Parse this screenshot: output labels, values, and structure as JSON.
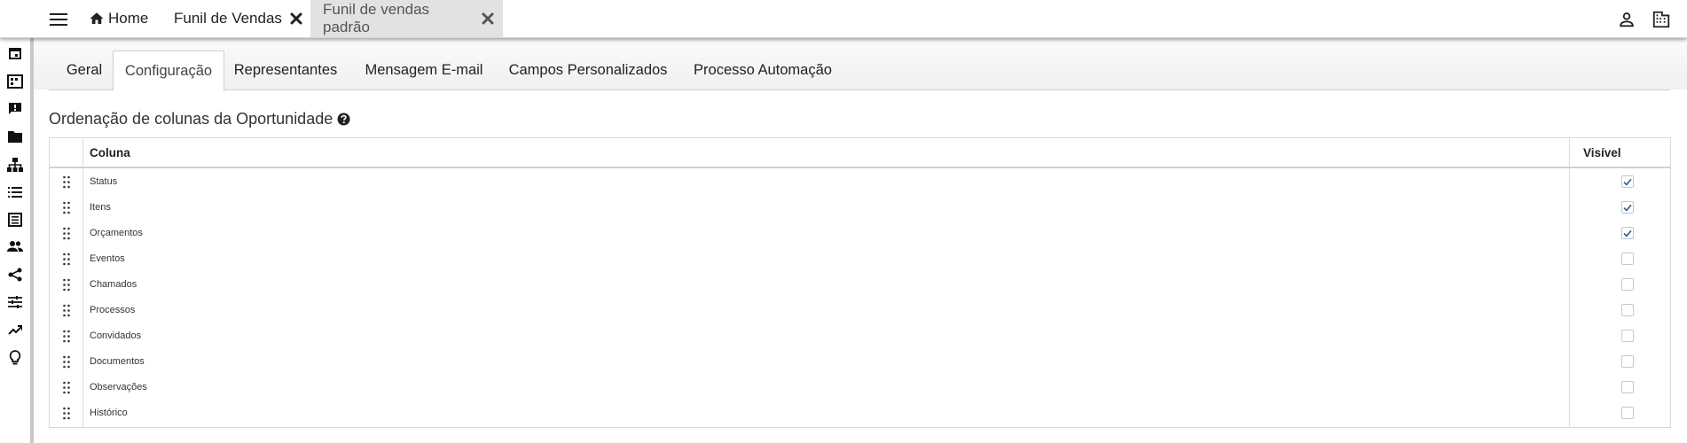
{
  "topbar": {
    "tabs": [
      {
        "label": "Home",
        "icon": "home-icon"
      },
      {
        "label": "Funil de Vendas",
        "icon": "close-icon"
      },
      {
        "label": "Funil de vendas padrão",
        "icon": "close-icon"
      }
    ],
    "right_icons": [
      "user-icon",
      "company-icon"
    ]
  },
  "sidebar": {
    "icons": [
      "calendar-icon",
      "kanban-icon",
      "feedback-icon",
      "folder-icon",
      "org-chart-icon",
      "list-icon",
      "report-icon",
      "people-icon",
      "share-icon",
      "sliders-icon",
      "trending-icon",
      "lightbulb-icon"
    ]
  },
  "subtabs": [
    {
      "label": "Geral",
      "active": false
    },
    {
      "label": "Configuração",
      "active": true
    },
    {
      "label": "Representantes",
      "active": false
    },
    {
      "label": "Mensagem E-mail",
      "active": false
    },
    {
      "label": "Campos Personalizados",
      "active": false
    },
    {
      "label": "Processo Automação",
      "active": false
    }
  ],
  "section": {
    "title": "Ordenação de colunas da Oportunidade"
  },
  "grid": {
    "headers": {
      "coluna": "Coluna",
      "visivel": "Visível"
    },
    "rows": [
      {
        "label": "Status",
        "visible": true
      },
      {
        "label": "Itens",
        "visible": true
      },
      {
        "label": "Orçamentos",
        "visible": true
      },
      {
        "label": "Eventos",
        "visible": false
      },
      {
        "label": "Chamados",
        "visible": false
      },
      {
        "label": "Processos",
        "visible": false
      },
      {
        "label": "Convidados",
        "visible": false
      },
      {
        "label": "Documentos",
        "visible": false
      },
      {
        "label": "Observações",
        "visible": false
      },
      {
        "label": "Histórico",
        "visible": false
      }
    ]
  },
  "colors": {
    "check": "#2f5a8f",
    "inactive_tab_bg": "#e2e2e2"
  }
}
